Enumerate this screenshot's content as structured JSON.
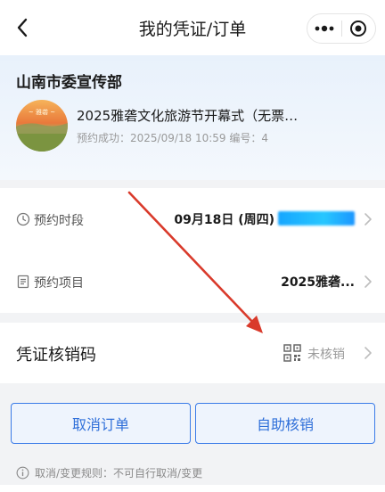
{
  "navbar": {
    "title": "我的凭证/订单",
    "icons": {
      "back": "chevron-left-icon",
      "more": "more-dots-icon",
      "close": "target-close-icon"
    }
  },
  "header": {
    "org_name": "山南市委宣传部",
    "event_title": "2025雅砻文化旅游节开幕式（无票…",
    "event_meta": "预约成功：2025/09/18 10:59 编号：4"
  },
  "info": {
    "time_label": "预约时段",
    "time_value": "09月18日 (周四)",
    "project_label": "预约项目",
    "project_value": "2025雅砻..."
  },
  "voucher": {
    "label": "凭证核销码",
    "status": "未核销"
  },
  "actions": {
    "cancel": "取消订单",
    "self_verify": "自助核销"
  },
  "rule": {
    "text": "取消/变更规则：不可自行取消/变更"
  },
  "colors": {
    "accent": "#2f6fd9",
    "accent_border": "#3a7be8",
    "annotation_arrow": "#d93a2b",
    "redaction": "#16a6ff"
  }
}
